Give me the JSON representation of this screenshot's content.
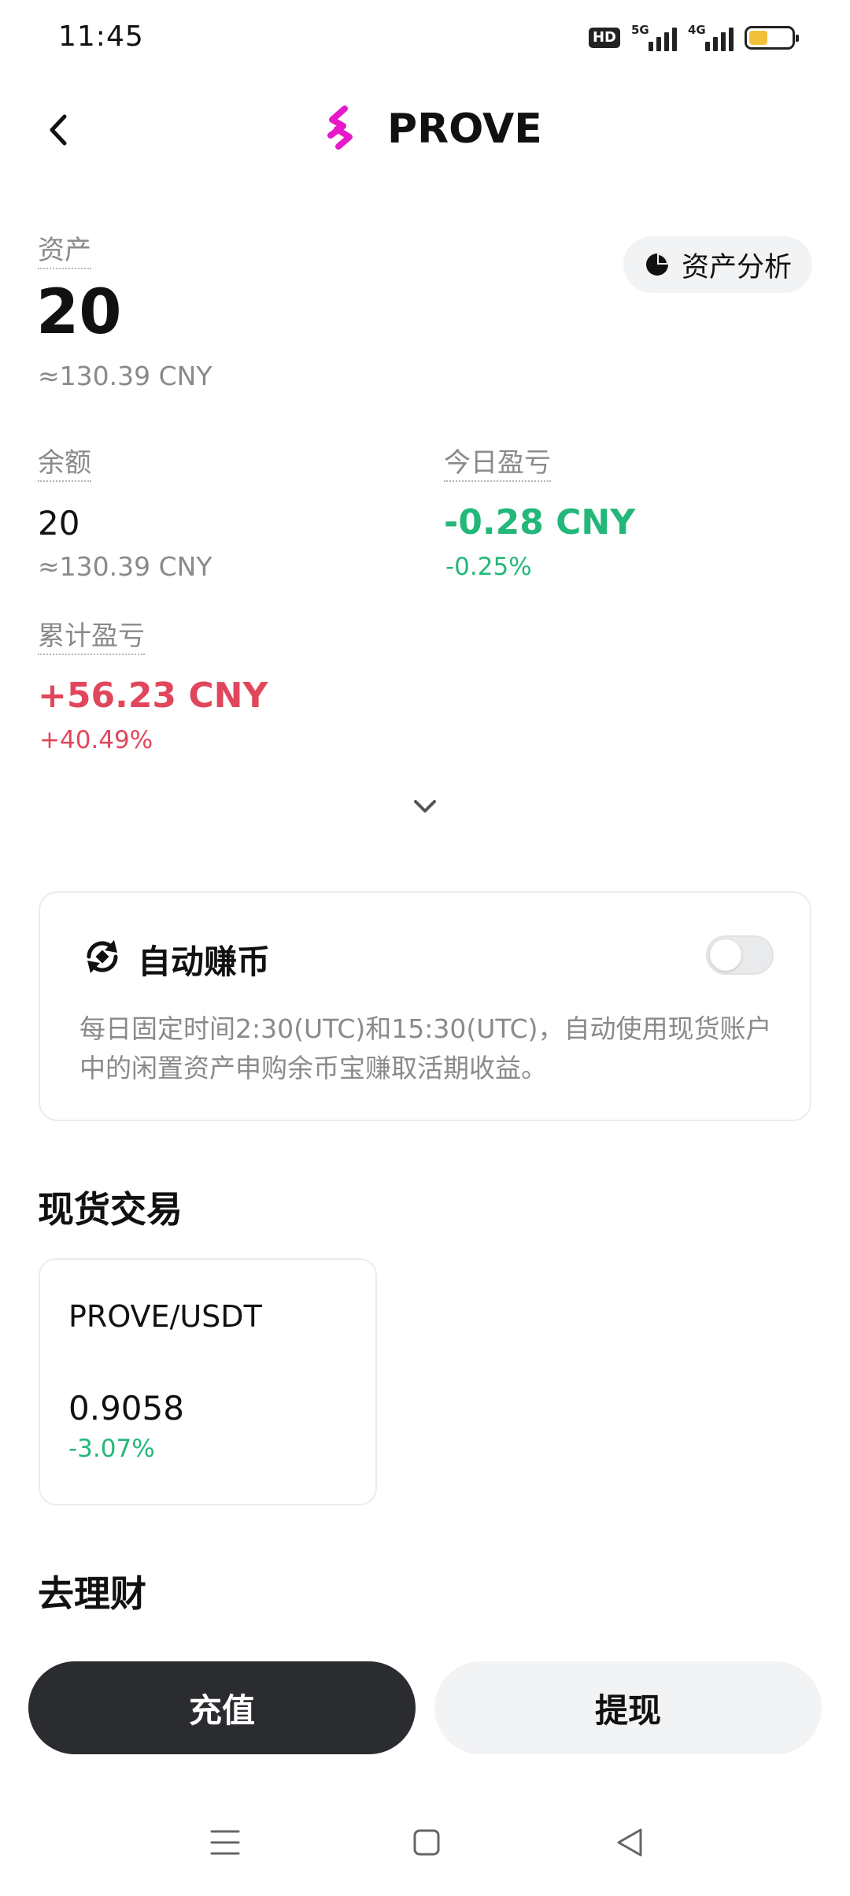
{
  "status_bar": {
    "time": "11:45",
    "hd": "HD",
    "net1": "5G",
    "net2": "4G",
    "battery_level": 0.45,
    "battery_color": "#f3c03a"
  },
  "header": {
    "title": "PROVE",
    "back_icon": "chevron-left-icon",
    "logo_icon": "prove-logo-icon",
    "logo_color": "#e619c8"
  },
  "assets": {
    "label": "资产",
    "amount": "20",
    "approx": "≈130.39 CNY",
    "analysis_label": "资产分析",
    "analysis_icon": "pie-chart-icon"
  },
  "balance": {
    "label": "余额",
    "amount": "20",
    "approx": "≈130.39 CNY"
  },
  "today_pnl": {
    "label": "今日盈亏",
    "amount": "-0.28 CNY",
    "percent": "-0.25%",
    "color": "#23b87a"
  },
  "total_pnl": {
    "label": "累计盈亏",
    "amount": "+56.23 CNY",
    "percent": "+40.49%",
    "color": "#e1475c"
  },
  "expand_icon": "chevron-down-icon",
  "auto_earn": {
    "title": "自动赚币",
    "icon": "auto-cycle-icon",
    "enabled": false,
    "description": "每日固定时间2:30(UTC)和15:30(UTC)，自动使用现货账户中的闲置资产申购余币宝赚取活期收益。"
  },
  "spot": {
    "section_title": "现货交易",
    "pairs": [
      {
        "name": "PROVE/USDT",
        "price": "0.9058",
        "change": "-3.07%"
      }
    ]
  },
  "finance": {
    "section_title": "去理财"
  },
  "actions": {
    "deposit": "充值",
    "withdraw": "提现"
  },
  "nav": {
    "menu_icon": "menu-icon",
    "home_icon": "home-square-icon",
    "back_icon": "back-triangle-icon"
  }
}
